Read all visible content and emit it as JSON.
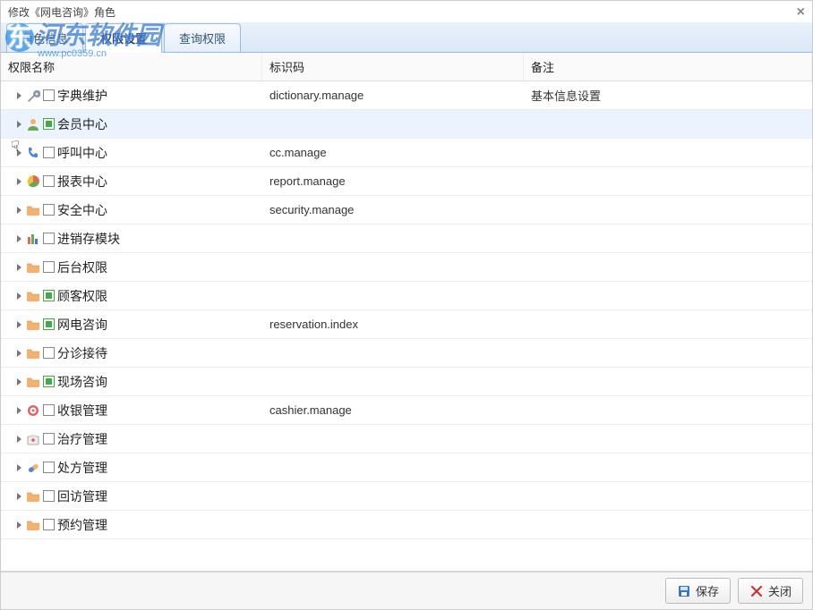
{
  "window": {
    "title": "修改《网电咨询》角色"
  },
  "watermark": "河东软件园",
  "watermark_sub": "www.pc0359.cn",
  "tabs": [
    {
      "label": "角色信息",
      "active": false
    },
    {
      "label": "权限设置",
      "active": true
    },
    {
      "label": "查询权限",
      "active": false
    }
  ],
  "columns": {
    "name": "权限名称",
    "code": "标识码",
    "remark": "备注"
  },
  "rows": [
    {
      "icon": "wrench",
      "check": "empty",
      "label": "字典维护",
      "code": "dictionary.manage",
      "remark": "基本信息设置",
      "selected": false
    },
    {
      "icon": "user",
      "check": "partial",
      "label": "会员中心",
      "code": "",
      "remark": "",
      "selected": true
    },
    {
      "icon": "phone",
      "check": "empty",
      "label": "呼叫中心",
      "code": "cc.manage",
      "remark": "",
      "selected": false
    },
    {
      "icon": "pie",
      "check": "empty",
      "label": "报表中心",
      "code": "report.manage",
      "remark": "",
      "selected": false
    },
    {
      "icon": "folder",
      "check": "empty",
      "label": "安全中心",
      "code": "security.manage",
      "remark": "",
      "selected": false
    },
    {
      "icon": "bars",
      "check": "empty",
      "label": "进销存模块",
      "code": "",
      "remark": "",
      "selected": false
    },
    {
      "icon": "folder",
      "check": "empty",
      "label": "后台权限",
      "code": "",
      "remark": "",
      "selected": false
    },
    {
      "icon": "folder",
      "check": "partial",
      "label": "顾客权限",
      "code": "",
      "remark": "",
      "selected": false
    },
    {
      "icon": "folder",
      "check": "partial",
      "label": "网电咨询",
      "code": "reservation.index",
      "remark": "",
      "selected": false
    },
    {
      "icon": "folder",
      "check": "empty",
      "label": "分诊接待",
      "code": "",
      "remark": "",
      "selected": false
    },
    {
      "icon": "folder",
      "check": "partial",
      "label": "现场咨询",
      "code": "",
      "remark": "",
      "selected": false
    },
    {
      "icon": "target",
      "check": "empty",
      "label": "收银管理",
      "code": "cashier.manage",
      "remark": "",
      "selected": false
    },
    {
      "icon": "medkit",
      "check": "empty",
      "label": "治疗管理",
      "code": "",
      "remark": "",
      "selected": false
    },
    {
      "icon": "pill",
      "check": "empty",
      "label": "处方管理",
      "code": "",
      "remark": "",
      "selected": false
    },
    {
      "icon": "folder",
      "check": "empty",
      "label": "回访管理",
      "code": "",
      "remark": "",
      "selected": false
    },
    {
      "icon": "folder",
      "check": "empty",
      "label": "预约管理",
      "code": "",
      "remark": "",
      "selected": false
    }
  ],
  "buttons": {
    "save": "保存",
    "close": "关闭"
  }
}
